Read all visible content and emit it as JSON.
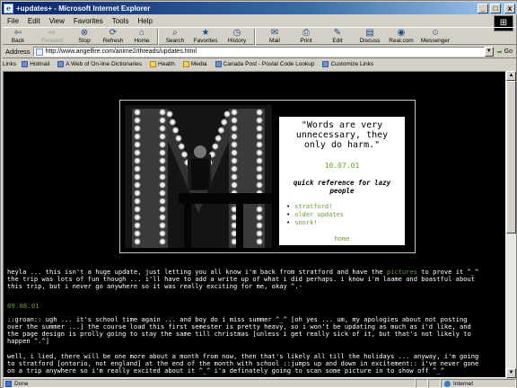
{
  "window": {
    "title": "+updates+ - Microsoft Internet Explorer",
    "buttons": {
      "minimize": "_",
      "maximize": "□",
      "close": "x"
    }
  },
  "menu": [
    "File",
    "Edit",
    "View",
    "Favorites",
    "Tools",
    "Help"
  ],
  "toolbar": [
    {
      "label": "Back",
      "icon": "back-arrow-icon",
      "glyph": "⇦"
    },
    {
      "label": "Forward",
      "icon": "forward-arrow-icon",
      "glyph": "⇨"
    },
    {
      "label": "Stop",
      "icon": "stop-icon",
      "glyph": "⊗"
    },
    {
      "label": "Refresh",
      "icon": "refresh-icon",
      "glyph": "⟳"
    },
    {
      "label": "Home",
      "icon": "home-icon",
      "glyph": "⌂"
    },
    {
      "label": "Search",
      "icon": "search-icon",
      "glyph": "⌕"
    },
    {
      "label": "Favorites",
      "icon": "favorites-icon",
      "glyph": "★"
    },
    {
      "label": "History",
      "icon": "history-icon",
      "glyph": "◷"
    },
    {
      "label": "Mail",
      "icon": "mail-icon",
      "glyph": "✉"
    },
    {
      "label": "Print",
      "icon": "print-icon",
      "glyph": "⎙"
    },
    {
      "label": "Edit",
      "icon": "edit-icon",
      "glyph": "✎"
    },
    {
      "label": "Discuss",
      "icon": "discuss-icon",
      "glyph": "▤"
    },
    {
      "label": "Real.com",
      "icon": "realcom-icon",
      "glyph": "◉"
    },
    {
      "label": "Messenger",
      "icon": "messenger-icon",
      "glyph": "☺"
    }
  ],
  "address": {
    "label": "Address",
    "url": "http://www.angelfire.com/anime2/threads/updates.html",
    "go": "Go"
  },
  "links": {
    "label": "Links",
    "items": [
      "Hotmail",
      "A Web of On-line Dictionaries",
      "Health",
      "Media",
      "Canada Post - Postal Code Lookup",
      "Customize Links"
    ]
  },
  "page": {
    "quote": "\"Words are very unnecessary, they only do harm.\"",
    "quote_date": "10.07.01",
    "quick_ref": "quick reference for lazy people",
    "quick_links": [
      "stratford!",
      "older updates",
      "snork!"
    ],
    "home": "home",
    "post1_before": "heyla ... this isn't a huge update, just letting you all know i'm back from stratford and have the ",
    "post1_link": "pictures",
    "post1_after": " to prove it ^_^",
    "post1_rest": "the trip was lots of fun though ... i'll have to add a write up of what i did perhaps. i know i'm laame and boastful about\nthis trip, but i never go anywhere so it was really exciting for me, okay ^.-",
    "date2": "09.08.01",
    "post2": "::groan:: ugh ... it's school time again ... and boy do i miss summer ^_^ [oh yes ... um, my apologies about not posting\nover the summer ...] the course load this first semester is pretty heavy, so i won't be updating as much as i'd like, and\nthe page design is prolly going to stay the same till christmas [unless i get really sick of it, but that's not likely to\nhappen ^.^]",
    "post3": "well, i lied, there will be one more about a month from now, then that's likely all till the holidays ... anyway, i'm going\nto stratford [ontario, not england] at the end of the month with school ::jumps up and down in excitement:: i've never gone\non a trip anywhere so i'm really excited about it ^_^ i'a definately going to scan some picture in to show off ^_^"
  },
  "status": {
    "left": "Done",
    "zone": "Internet"
  },
  "colors": {
    "accent": "#6b9d34",
    "background": "#000000",
    "title_bar": "#0a246a"
  }
}
